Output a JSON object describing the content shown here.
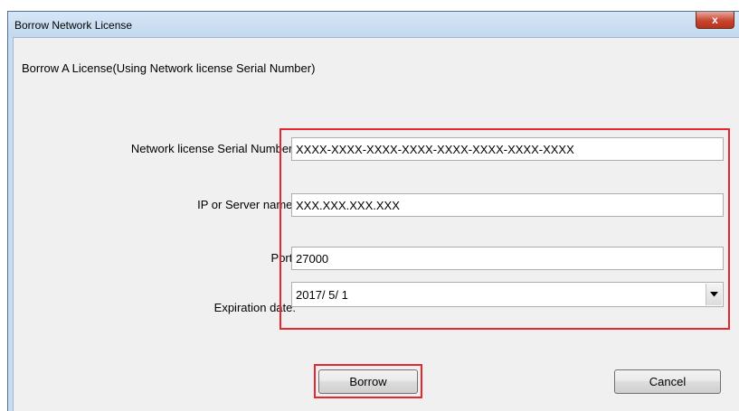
{
  "window": {
    "title": "Borrow Network License",
    "close_glyph": "x"
  },
  "heading": "Borrow A License(Using Network license Serial Number)",
  "fields": {
    "serial": {
      "label": "Network license Serial Number:",
      "value": "XXXX-XXXX-XXXX-XXXX-XXXX-XXXX-XXXX-XXXX"
    },
    "server": {
      "label": "IP or Server name:",
      "value": "XXX.XXX.XXX.XXX"
    },
    "port": {
      "label": "Port:",
      "value": "27000"
    },
    "expiration": {
      "label": "Expiration date:",
      "value": "2017/ 5/ 1"
    }
  },
  "buttons": {
    "borrow": "Borrow",
    "cancel": "Cancel"
  },
  "colors": {
    "highlight": "#e8272d",
    "title_bar": "#c9ddf2",
    "close_button": "#c8452f"
  },
  "icons": {
    "close": "close-icon",
    "dropdown": "chevron-down-icon"
  }
}
